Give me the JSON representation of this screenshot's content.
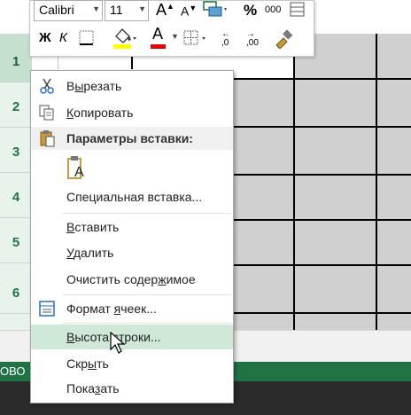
{
  "toolbar": {
    "font_name": "Calibri",
    "font_size": "11",
    "bold_label": "Ж",
    "italic_label": "К",
    "percent_label": "%",
    "thousands_label": "000",
    "increase_font_label": "A",
    "decrease_font_label": "A",
    "font_color_label": "A",
    "increase_decimal_label": ",0",
    "decrease_decimal_label": ",00",
    "accent_font_color": "#e00000",
    "accent_fill_color": "#ffff00"
  },
  "sheet": {
    "rows": [
      "1",
      "2",
      "3",
      "4",
      "5",
      "6"
    ],
    "selected_row": "1"
  },
  "status": {
    "text": "ОВО"
  },
  "context_menu": {
    "items": [
      {
        "label": "Вырезать",
        "icon": "scissors-icon",
        "hotkey": "ы"
      },
      {
        "label": "Копировать",
        "icon": "copy-icon",
        "hotkey": "К"
      },
      {
        "label": "Параметры вставки:",
        "icon": "paste-icon"
      },
      {
        "label": "A",
        "icon": "paste-option-icon"
      },
      {
        "label": "Специальная вставка...",
        "icon": ""
      },
      {
        "label": "Вставить",
        "icon": "",
        "hotkey": "В"
      },
      {
        "label": "Удалить",
        "icon": "",
        "hotkey": "У"
      },
      {
        "label": "Очистить содержимое",
        "icon": "",
        "hotkey": "ж"
      },
      {
        "label": "Формат ячеек...",
        "icon": "format-cells-icon",
        "hotkey": "я"
      },
      {
        "label": "Высота строки...",
        "icon": "",
        "hotkey": "В"
      },
      {
        "label": "Скрыть",
        "icon": "",
        "hotkey": "ы"
      },
      {
        "label": "Показать",
        "icon": "",
        "hotkey": "з"
      }
    ]
  }
}
